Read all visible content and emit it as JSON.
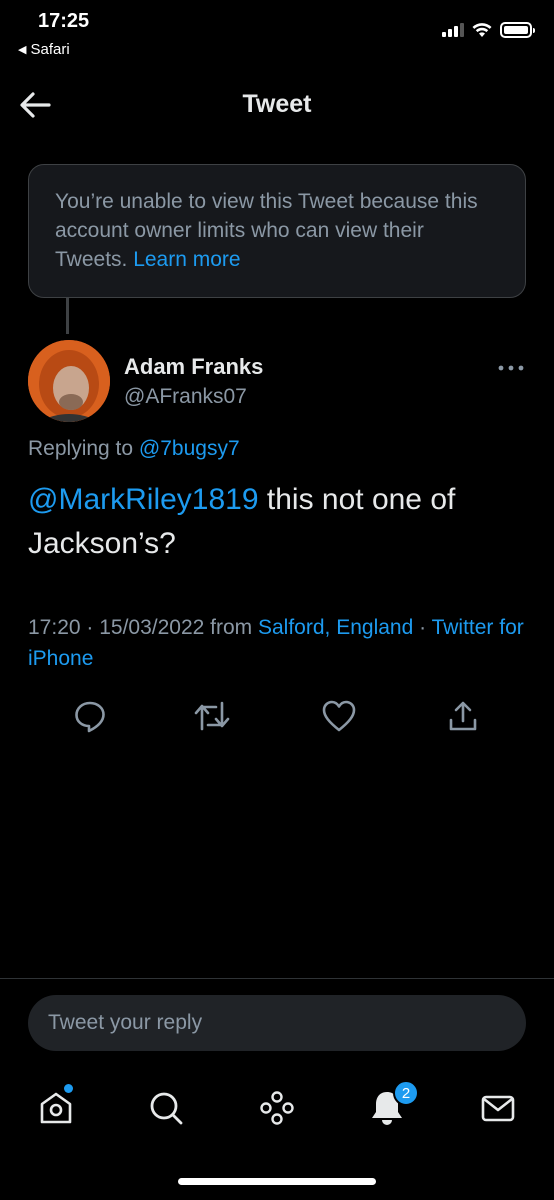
{
  "status_bar": {
    "time": "17:25",
    "back_app": "Safari",
    "signal_bars_active": 3,
    "signal_bars_total": 4,
    "wifi_icon": "wifi-icon",
    "battery_level": 1.0
  },
  "nav": {
    "title": "Tweet",
    "back_icon": "arrow-left-icon"
  },
  "notice": {
    "text": "You’re unable to view this Tweet because this account owner limits who can view their Tweets. ",
    "link": "Learn more"
  },
  "tweet": {
    "author_name": "Adam Franks",
    "author_handle": "@AFranks07",
    "more_icon": "more-dots-icon",
    "replying_prefix": "Replying to ",
    "replying_to": "@7bugsy7",
    "mention": "@MarkRiley1819",
    "text": " this not one of Jackson’s?",
    "time": "17:20 · 15/03/2022 from ",
    "location": "Salford, England",
    "separator": " · ",
    "source": "Twitter for iPhone"
  },
  "actions": [
    {
      "icon": "reply-icon"
    },
    {
      "icon": "retweet-icon"
    },
    {
      "icon": "like-heart-icon"
    },
    {
      "icon": "share-icon"
    }
  ],
  "reply_box": {
    "placeholder": "Tweet your reply"
  },
  "tabbar": {
    "items": [
      {
        "icon": "home-icon",
        "has_dot": true
      },
      {
        "icon": "search-icon"
      },
      {
        "icon": "spaces-icon"
      },
      {
        "icon": "notifications-bell-icon",
        "badge": "2"
      },
      {
        "icon": "messages-envelope-icon"
      }
    ]
  },
  "colors": {
    "background": "#000000",
    "accent": "#1d9bf0",
    "secondary_text": "#8b98a5",
    "primary_text": "#e7e9ea"
  }
}
